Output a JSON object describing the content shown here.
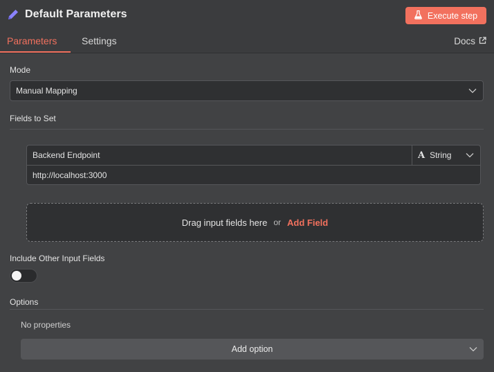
{
  "header": {
    "title": "Default Parameters",
    "execute_label": "Execute step",
    "tabs": [
      {
        "label": "Parameters",
        "active": true
      },
      {
        "label": "Settings",
        "active": false
      }
    ],
    "docs_label": "Docs"
  },
  "form": {
    "mode": {
      "label": "Mode",
      "value": "Manual Mapping"
    },
    "fields_to_set": {
      "label": "Fields to Set",
      "fields": [
        {
          "name": "Backend Endpoint",
          "type": "String",
          "value": "http://localhost:3000"
        }
      ],
      "drop_text": "Drag input fields here",
      "or_text": "or",
      "add_field_label": "Add Field"
    },
    "include_other": {
      "label": "Include Other Input Fields",
      "enabled": false
    },
    "options": {
      "label": "Options",
      "empty_text": "No properties",
      "add_option_label": "Add option"
    }
  },
  "colors": {
    "accent": "#f2715e",
    "background": "#414244",
    "input_bg": "#2f3032"
  },
  "icons": {
    "title": "pencil-icon",
    "execute": "flask-icon",
    "docs": "external-link-icon",
    "type": "string-type-icon",
    "dropdown": "chevron-down-icon"
  }
}
